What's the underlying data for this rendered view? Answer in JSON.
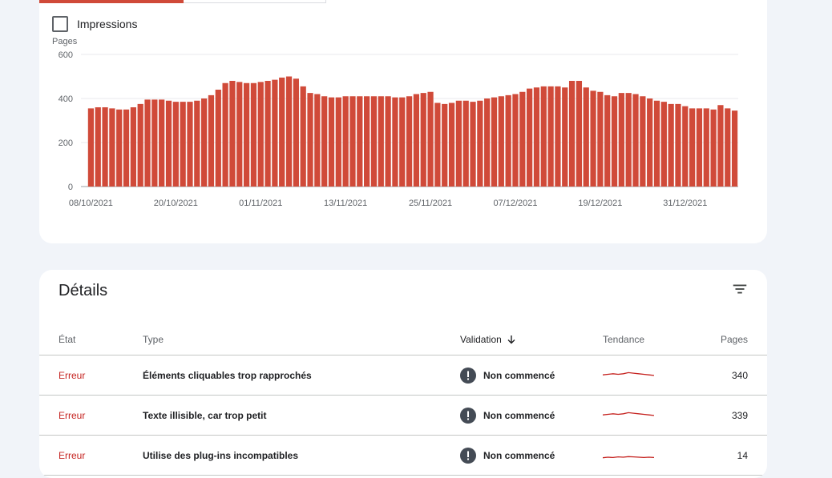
{
  "chart_section": {
    "impressions_label": "Impressions",
    "impressions_checked": false,
    "accent_color": "#d04a39"
  },
  "chart_data": {
    "type": "bar",
    "ylabel": "Pages",
    "ylim": [
      0,
      600
    ],
    "yticks": [
      0,
      200,
      400,
      600
    ],
    "xtick_labels": [
      "08/10/2021",
      "20/10/2021",
      "01/11/2021",
      "13/11/2021",
      "25/11/2021",
      "07/12/2021",
      "19/12/2021",
      "31/12/2021"
    ],
    "xtick_indices": [
      0,
      12,
      24,
      36,
      48,
      60,
      72,
      84
    ],
    "grid": true,
    "color": "#d04a39",
    "values": [
      355,
      360,
      360,
      355,
      350,
      350,
      360,
      375,
      395,
      395,
      395,
      390,
      385,
      385,
      385,
      390,
      400,
      415,
      440,
      470,
      480,
      475,
      470,
      470,
      475,
      480,
      485,
      495,
      500,
      490,
      455,
      425,
      420,
      410,
      405,
      405,
      410,
      410,
      410,
      410,
      410,
      410,
      410,
      405,
      405,
      410,
      420,
      425,
      430,
      380,
      375,
      380,
      390,
      390,
      385,
      390,
      400,
      405,
      410,
      415,
      420,
      430,
      445,
      450,
      455,
      455,
      455,
      450,
      480,
      480,
      450,
      435,
      430,
      415,
      410,
      425,
      425,
      420,
      410,
      400,
      390,
      385,
      375,
      375,
      365,
      355,
      355,
      355,
      350,
      370,
      355,
      345
    ]
  },
  "details": {
    "title": "Détails",
    "filter_icon": "filter-icon",
    "columns": {
      "etat": "État",
      "type": "Type",
      "validation": "Validation",
      "tendance": "Tendance",
      "pages": "Pages"
    },
    "status_color": "#c5221f",
    "rows": [
      {
        "status": "Erreur",
        "type": "Éléments cliquables trop rapprochés",
        "validation": "Non commencé",
        "pages": "340",
        "trend": [
          0.55,
          0.5,
          0.45,
          0.5,
          0.45,
          0.35,
          0.4,
          0.45,
          0.5,
          0.55,
          0.6
        ]
      },
      {
        "status": "Erreur",
        "type": "Texte illisible, car trop petit",
        "validation": "Non commencé",
        "pages": "339",
        "trend": [
          0.55,
          0.5,
          0.45,
          0.5,
          0.45,
          0.35,
          0.4,
          0.45,
          0.5,
          0.55,
          0.6
        ]
      },
      {
        "status": "Erreur",
        "type": "Utilise des plug-ins incompatibles",
        "validation": "Non commencé",
        "pages": "14",
        "trend": [
          0.8,
          0.75,
          0.78,
          0.72,
          0.75,
          0.7,
          0.72,
          0.75,
          0.78,
          0.75,
          0.78
        ]
      }
    ]
  }
}
